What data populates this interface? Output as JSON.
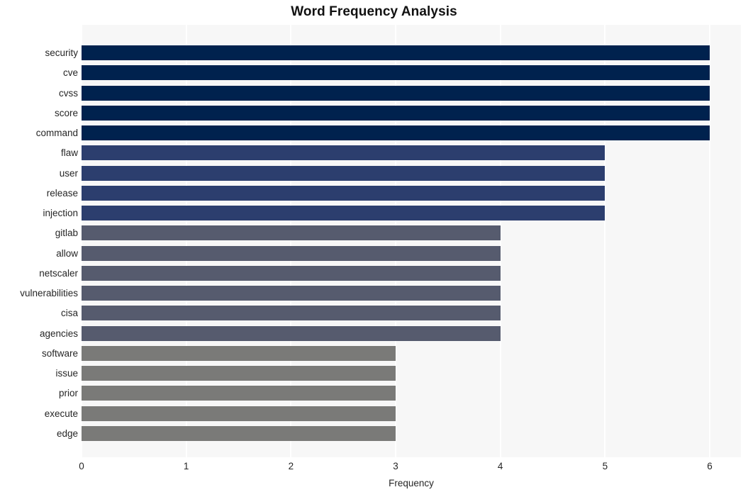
{
  "chart_data": {
    "type": "bar",
    "orientation": "horizontal",
    "title": "Word Frequency Analysis",
    "xlabel": "Frequency",
    "ylabel": "",
    "xlim": [
      0,
      6
    ],
    "xticks": [
      0,
      1,
      2,
      3,
      4,
      5,
      6
    ],
    "xtick_labels": [
      "0",
      "1",
      "2",
      "3",
      "4",
      "5",
      "6"
    ],
    "grid": "vertical-white-on-light-gray",
    "legend": "none",
    "categories": [
      "security",
      "cve",
      "cvss",
      "score",
      "command",
      "flaw",
      "user",
      "release",
      "injection",
      "gitlab",
      "allow",
      "netscaler",
      "vulnerabilities",
      "cisa",
      "agencies",
      "software",
      "issue",
      "prior",
      "execute",
      "edge"
    ],
    "values": [
      6,
      6,
      6,
      6,
      6,
      5,
      5,
      5,
      5,
      4,
      4,
      4,
      4,
      4,
      4,
      3,
      3,
      3,
      3,
      3
    ],
    "bar_colors": [
      "#00224e",
      "#00224e",
      "#00224e",
      "#00224e",
      "#00224e",
      "#2c3e6e",
      "#2c3e6e",
      "#2c3e6e",
      "#2c3e6e",
      "#565b6e",
      "#565b6e",
      "#565b6e",
      "#565b6e",
      "#565b6e",
      "#565b6e",
      "#7a7a78",
      "#7a7a78",
      "#7a7a78",
      "#7a7a78",
      "#7a7a78"
    ],
    "colors": {
      "group_6": "#00224e",
      "group_5": "#2c3e6e",
      "group_4": "#565b6e",
      "group_3": "#7a7a78",
      "plot_background": "#f7f7f7",
      "gridline": "#ffffff",
      "page_background": "#ffffff",
      "text": "#262626",
      "title": "#111111"
    }
  }
}
